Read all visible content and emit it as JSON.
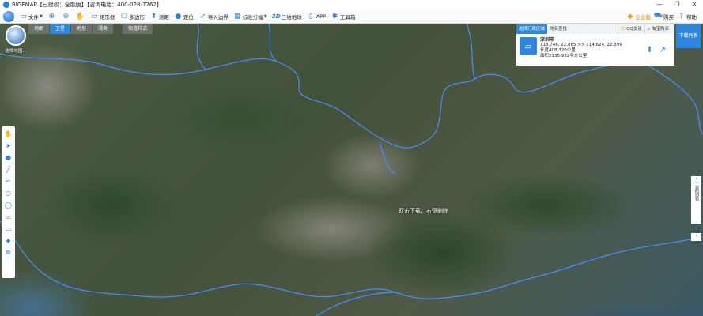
{
  "window": {
    "title": "BIGEMAP【已授权：全能版】【咨询电话：400-028-7262】",
    "controls": [
      "—",
      "❐",
      "✕"
    ]
  },
  "toolbar": {
    "items": [
      {
        "icon": "folder-icon",
        "glyph": "▭",
        "label": "文件"
      },
      {
        "icon": "zoom-in-icon",
        "glyph": "⊕",
        "label": ""
      },
      {
        "icon": "zoom-out-icon",
        "glyph": "⊖",
        "label": ""
      },
      {
        "icon": "hand-icon",
        "glyph": "✋",
        "label": ""
      },
      {
        "icon": "rectangle-select-icon",
        "glyph": "▭",
        "label": "矩形框"
      },
      {
        "icon": "polygon-icon",
        "glyph": "⬠",
        "label": "多边形"
      },
      {
        "icon": "ruler-icon",
        "glyph": "⬍",
        "label": "测距"
      },
      {
        "icon": "location-pin-icon",
        "glyph": "●",
        "label": "定位"
      },
      {
        "icon": "import-boundary-icon",
        "glyph": "➶",
        "label": "导入边界"
      },
      {
        "icon": "grid-icon",
        "glyph": "▦",
        "label": "标准分幅"
      },
      {
        "icon": "3d-icon",
        "glyph": "3D",
        "label": "三维地球"
      },
      {
        "icon": "app-icon",
        "glyph": "▯",
        "label": "APP"
      },
      {
        "icon": "gear-icon",
        "glyph": "✱",
        "label": "工具箱"
      }
    ],
    "right_items": [
      {
        "icon": "enterprise-icon",
        "glyph": "◆",
        "label": "企业版"
      },
      {
        "icon": "cart-icon",
        "glyph": "⛟",
        "label": "购买"
      },
      {
        "icon": "help-icon",
        "glyph": "?",
        "label": "帮助"
      }
    ]
  },
  "map_modes": {
    "tabs": [
      "地图",
      "卫星",
      "地形",
      "混合"
    ],
    "active": 1,
    "street_style": "街道样式"
  },
  "select_map": {
    "label": "选择地图..."
  },
  "left_tools": [
    "✋",
    "➤",
    "●",
    "╱",
    "⌐",
    "○",
    "◯",
    "⌓",
    "▭",
    "⬥",
    "⧉"
  ],
  "region_panel": {
    "tabs": {
      "select_region": "选择行政区域",
      "place_search": "地名查找"
    },
    "right_tabs": {
      "qq": "QQ交谈",
      "taobao": "淘宝购买"
    },
    "city": "深圳市",
    "coords": "113.746, 22.865 >> 114.624, 22.399",
    "perimeter": "长度408.320公里",
    "area": "面积2135.932平方公里"
  },
  "download_list": {
    "label": "下载列表"
  },
  "right_tool": {
    "label": "工具列表",
    "arrow": "‹"
  },
  "map_hint": "双击下载，右键删除",
  "colors": {
    "accent": "#2f86e0",
    "boundary": "#4a8cff"
  }
}
